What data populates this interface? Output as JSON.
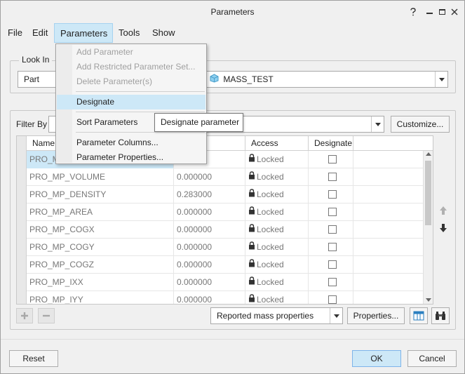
{
  "window": {
    "title": "Parameters"
  },
  "menubar": {
    "items": [
      "File",
      "Edit",
      "Parameters",
      "Tools",
      "Show"
    ]
  },
  "look_in": {
    "legend": "Look In",
    "type_value": "Part",
    "object_value": "MASS_TEST"
  },
  "filter": {
    "label": "Filter By",
    "customize_label": "Customize..."
  },
  "table": {
    "columns": [
      "Name",
      "Access",
      "Designate"
    ],
    "rows": [
      {
        "name": "PRO_M",
        "value": "",
        "access": "Locked"
      },
      {
        "name": "PRO_MP_VOLUME",
        "value": "0.000000",
        "access": "Locked"
      },
      {
        "name": "PRO_MP_DENSITY",
        "value": "0.283000",
        "access": "Locked"
      },
      {
        "name": "PRO_MP_AREA",
        "value": "0.000000",
        "access": "Locked"
      },
      {
        "name": "PRO_MP_COGX",
        "value": "0.000000",
        "access": "Locked"
      },
      {
        "name": "PRO_MP_COGY",
        "value": "0.000000",
        "access": "Locked"
      },
      {
        "name": "PRO_MP_COGZ",
        "value": "0.000000",
        "access": "Locked"
      },
      {
        "name": "PRO_MP_IXX",
        "value": "0.000000",
        "access": "Locked"
      },
      {
        "name": "PRO_MP_IYY",
        "value": "0.000000",
        "access": "Locked"
      }
    ]
  },
  "bottom_toolbar": {
    "reported_value": "Reported mass properties",
    "properties_label": "Properties..."
  },
  "footer": {
    "reset_label": "Reset",
    "ok_label": "OK",
    "cancel_label": "Cancel"
  },
  "parameters_menu": {
    "add_parameter": "Add Parameter",
    "add_restricted": "Add Restricted Parameter Set...",
    "delete_parameters": "Delete Parameter(s)",
    "designate": "Designate",
    "sort_parameters": "Sort Parameters",
    "parameter_columns": "Parameter Columns...",
    "parameter_properties": "Parameter Properties..."
  },
  "tooltip": {
    "text": "Designate parameter"
  },
  "colors": {
    "accent": "#cde8f7",
    "accent_border": "#7eb4ea"
  }
}
